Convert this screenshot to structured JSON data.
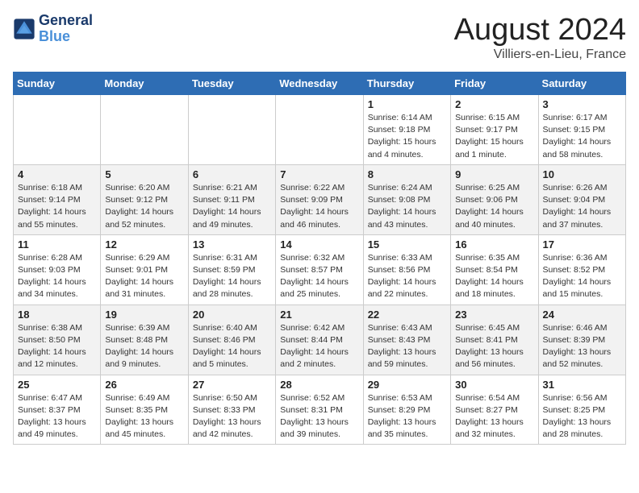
{
  "header": {
    "logo_line1": "General",
    "logo_line2": "Blue",
    "month_year": "August 2024",
    "location": "Villiers-en-Lieu, France"
  },
  "days_of_week": [
    "Sunday",
    "Monday",
    "Tuesday",
    "Wednesday",
    "Thursday",
    "Friday",
    "Saturday"
  ],
  "weeks": [
    [
      {
        "day": "",
        "info": ""
      },
      {
        "day": "",
        "info": ""
      },
      {
        "day": "",
        "info": ""
      },
      {
        "day": "",
        "info": ""
      },
      {
        "day": "1",
        "info": "Sunrise: 6:14 AM\nSunset: 9:18 PM\nDaylight: 15 hours\nand 4 minutes."
      },
      {
        "day": "2",
        "info": "Sunrise: 6:15 AM\nSunset: 9:17 PM\nDaylight: 15 hours\nand 1 minute."
      },
      {
        "day": "3",
        "info": "Sunrise: 6:17 AM\nSunset: 9:15 PM\nDaylight: 14 hours\nand 58 minutes."
      }
    ],
    [
      {
        "day": "4",
        "info": "Sunrise: 6:18 AM\nSunset: 9:14 PM\nDaylight: 14 hours\nand 55 minutes."
      },
      {
        "day": "5",
        "info": "Sunrise: 6:20 AM\nSunset: 9:12 PM\nDaylight: 14 hours\nand 52 minutes."
      },
      {
        "day": "6",
        "info": "Sunrise: 6:21 AM\nSunset: 9:11 PM\nDaylight: 14 hours\nand 49 minutes."
      },
      {
        "day": "7",
        "info": "Sunrise: 6:22 AM\nSunset: 9:09 PM\nDaylight: 14 hours\nand 46 minutes."
      },
      {
        "day": "8",
        "info": "Sunrise: 6:24 AM\nSunset: 9:08 PM\nDaylight: 14 hours\nand 43 minutes."
      },
      {
        "day": "9",
        "info": "Sunrise: 6:25 AM\nSunset: 9:06 PM\nDaylight: 14 hours\nand 40 minutes."
      },
      {
        "day": "10",
        "info": "Sunrise: 6:26 AM\nSunset: 9:04 PM\nDaylight: 14 hours\nand 37 minutes."
      }
    ],
    [
      {
        "day": "11",
        "info": "Sunrise: 6:28 AM\nSunset: 9:03 PM\nDaylight: 14 hours\nand 34 minutes."
      },
      {
        "day": "12",
        "info": "Sunrise: 6:29 AM\nSunset: 9:01 PM\nDaylight: 14 hours\nand 31 minutes."
      },
      {
        "day": "13",
        "info": "Sunrise: 6:31 AM\nSunset: 8:59 PM\nDaylight: 14 hours\nand 28 minutes."
      },
      {
        "day": "14",
        "info": "Sunrise: 6:32 AM\nSunset: 8:57 PM\nDaylight: 14 hours\nand 25 minutes."
      },
      {
        "day": "15",
        "info": "Sunrise: 6:33 AM\nSunset: 8:56 PM\nDaylight: 14 hours\nand 22 minutes."
      },
      {
        "day": "16",
        "info": "Sunrise: 6:35 AM\nSunset: 8:54 PM\nDaylight: 14 hours\nand 18 minutes."
      },
      {
        "day": "17",
        "info": "Sunrise: 6:36 AM\nSunset: 8:52 PM\nDaylight: 14 hours\nand 15 minutes."
      }
    ],
    [
      {
        "day": "18",
        "info": "Sunrise: 6:38 AM\nSunset: 8:50 PM\nDaylight: 14 hours\nand 12 minutes."
      },
      {
        "day": "19",
        "info": "Sunrise: 6:39 AM\nSunset: 8:48 PM\nDaylight: 14 hours\nand 9 minutes."
      },
      {
        "day": "20",
        "info": "Sunrise: 6:40 AM\nSunset: 8:46 PM\nDaylight: 14 hours\nand 5 minutes."
      },
      {
        "day": "21",
        "info": "Sunrise: 6:42 AM\nSunset: 8:44 PM\nDaylight: 14 hours\nand 2 minutes."
      },
      {
        "day": "22",
        "info": "Sunrise: 6:43 AM\nSunset: 8:43 PM\nDaylight: 13 hours\nand 59 minutes."
      },
      {
        "day": "23",
        "info": "Sunrise: 6:45 AM\nSunset: 8:41 PM\nDaylight: 13 hours\nand 56 minutes."
      },
      {
        "day": "24",
        "info": "Sunrise: 6:46 AM\nSunset: 8:39 PM\nDaylight: 13 hours\nand 52 minutes."
      }
    ],
    [
      {
        "day": "25",
        "info": "Sunrise: 6:47 AM\nSunset: 8:37 PM\nDaylight: 13 hours\nand 49 minutes."
      },
      {
        "day": "26",
        "info": "Sunrise: 6:49 AM\nSunset: 8:35 PM\nDaylight: 13 hours\nand 45 minutes."
      },
      {
        "day": "27",
        "info": "Sunrise: 6:50 AM\nSunset: 8:33 PM\nDaylight: 13 hours\nand 42 minutes."
      },
      {
        "day": "28",
        "info": "Sunrise: 6:52 AM\nSunset: 8:31 PM\nDaylight: 13 hours\nand 39 minutes."
      },
      {
        "day": "29",
        "info": "Sunrise: 6:53 AM\nSunset: 8:29 PM\nDaylight: 13 hours\nand 35 minutes."
      },
      {
        "day": "30",
        "info": "Sunrise: 6:54 AM\nSunset: 8:27 PM\nDaylight: 13 hours\nand 32 minutes."
      },
      {
        "day": "31",
        "info": "Sunrise: 6:56 AM\nSunset: 8:25 PM\nDaylight: 13 hours\nand 28 minutes."
      }
    ]
  ]
}
